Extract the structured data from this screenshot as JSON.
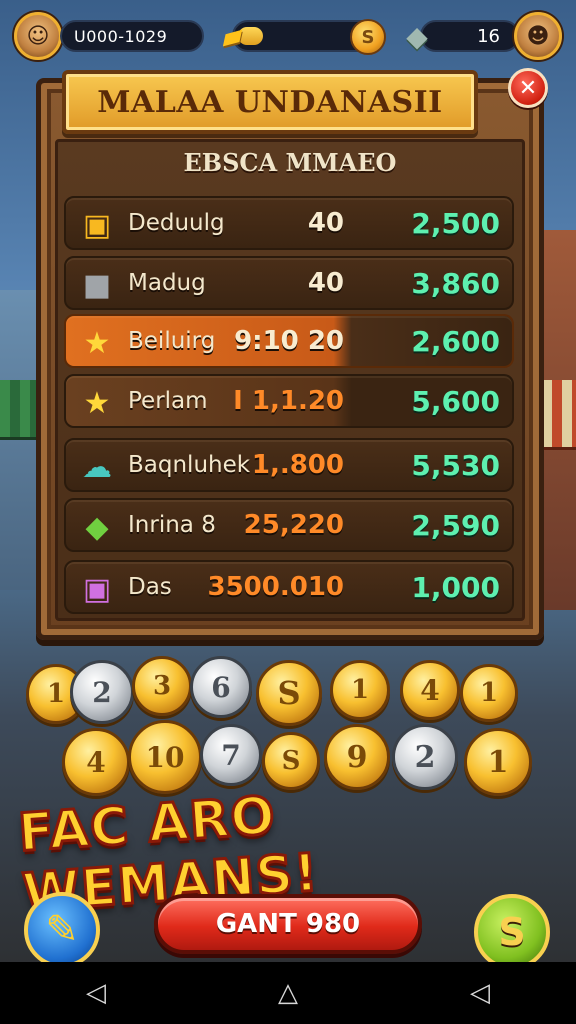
{
  "hud": {
    "score_text": "U000-1029",
    "gold_progress": 0.18,
    "coin_symbol": "S",
    "gem_count": "16",
    "left_avatar_icon": "player-avatar",
    "right_avatar_icon": "opponent-avatar",
    "gold_icon": "gold-bar-icon",
    "gem_icon": "gem-icon"
  },
  "panel": {
    "title": "MALAA UNDANASII",
    "subtitle": "EBSCA MMAEO",
    "close_icon": "close-icon",
    "rows": [
      {
        "icon": "gift-box-icon",
        "name": "Deduulg",
        "mid": "40",
        "right": "2,500",
        "style": "normal"
      },
      {
        "icon": "stone-block-icon",
        "name": "Madug",
        "mid": "40",
        "right": "3,860",
        "style": "normal"
      },
      {
        "icon": "star-icon",
        "name": "Beiluirg",
        "mid": "9:10 20",
        "right": "2,600",
        "style": "highlight"
      },
      {
        "icon": "star-icon",
        "name": "Perlam",
        "mid": "I 1,1.20",
        "right": "5,600",
        "style": "subtle"
      },
      {
        "icon": "cloud-gem-icon",
        "name": "Baqnluhek",
        "mid": "1,.800",
        "right": "5,530",
        "style": "normal"
      },
      {
        "icon": "green-gem-icon",
        "name": "Inrina  8",
        "mid": "25,220",
        "right": "2,590",
        "style": "normal"
      },
      {
        "icon": "present-icon",
        "name": "Das",
        "mid": "3500.010",
        "right": "1,000",
        "style": "normal"
      }
    ]
  },
  "coins": [
    "1",
    "2",
    "3",
    "6",
    "S",
    "1",
    "4",
    "1",
    "4",
    "10",
    "7",
    "S",
    "9",
    "2",
    "1"
  ],
  "banner_text": "FAC ARO WEMANS!",
  "cta_label": "GANT 980",
  "round_left_icon": "pencil-icon",
  "round_right_symbol": "S",
  "nav": {
    "back": "◁",
    "home": "△",
    "recent": "◁"
  }
}
